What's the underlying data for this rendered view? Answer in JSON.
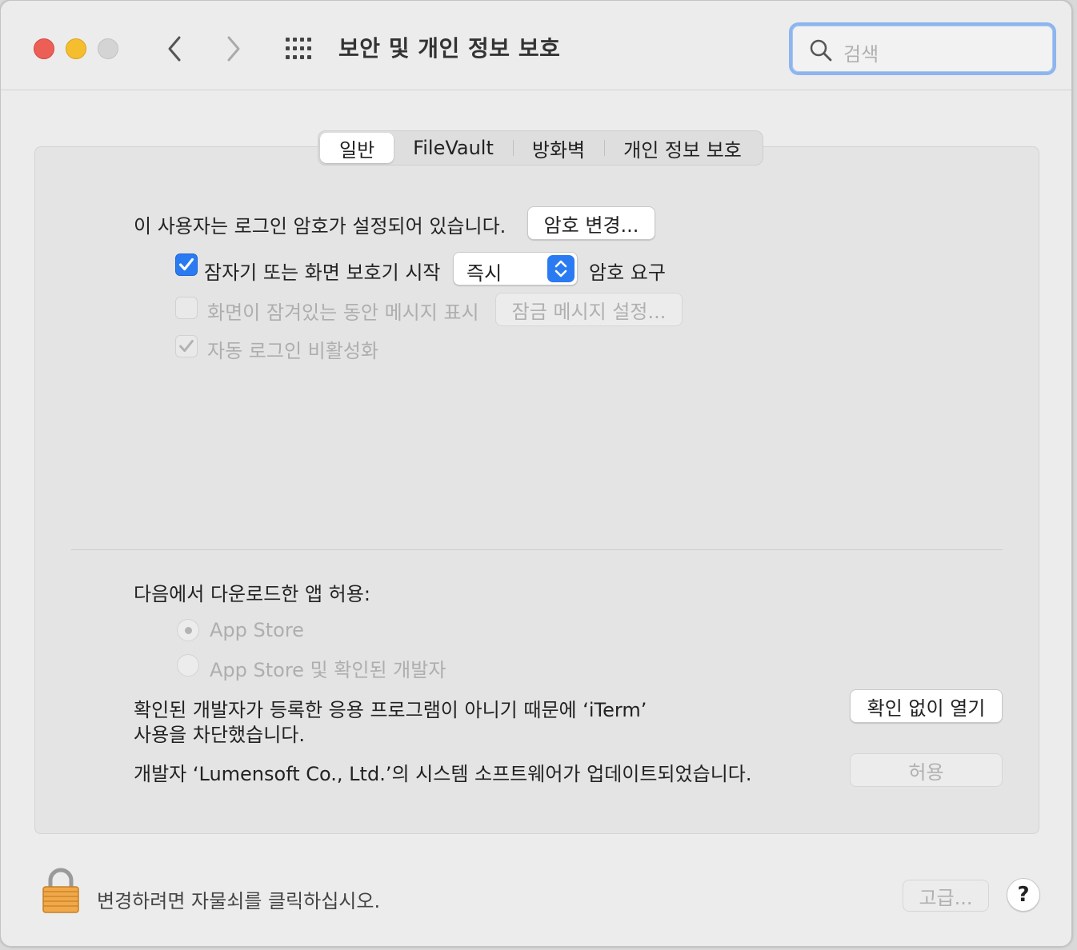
{
  "window": {
    "title": "보안 및 개인 정보 보호",
    "search_placeholder": "검색"
  },
  "tabs": [
    "일반",
    "FileVault",
    "방화벽",
    "개인 정보 보호"
  ],
  "general": {
    "password_text": "이 사용자는 로그인 암호가 설정되어 있습니다.",
    "change_password_button": "암호 변경...",
    "require_password_label": "잠자기 또는 화면 보호기 시작",
    "require_password_checked": true,
    "require_password_delay": "즉시",
    "require_password_suffix": "암호 요구",
    "show_message_label": "화면이 잠겨있는 동안 메시지 표시",
    "show_message_checked": false,
    "set_lock_message_button": "잠금 메시지 설정...",
    "disable_autologin_label": "자동 로그인 비활성화",
    "disable_autologin_checked": true
  },
  "downloads": {
    "heading": "다음에서 다운로드한 앱 허용:",
    "option_app_store": "App Store",
    "option_identified": "App Store 및 확인된 개발자",
    "selected": "App Store",
    "blocked_line1": "확인된 개발자가 등록한 응용 프로그램이 아니기 때문에 ‘iTerm’",
    "blocked_line2": "사용을 차단했습니다.",
    "open_anyway_button": "확인 없이 열기",
    "system_software_text": "개발자 ‘Lumensoft Co., Ltd.’의 시스템 소프트웨어가 업데이트되었습니다.",
    "allow_button": "허용"
  },
  "footer": {
    "lock_text": "변경하려면 자물쇠를 클릭하십시오.",
    "advanced_button": "고급...",
    "help_button": "?"
  },
  "colors": {
    "accent": "#2a7bf2",
    "close": "#ec5f57",
    "minimize": "#f4be2f",
    "search_focus": "#8db5ee"
  }
}
